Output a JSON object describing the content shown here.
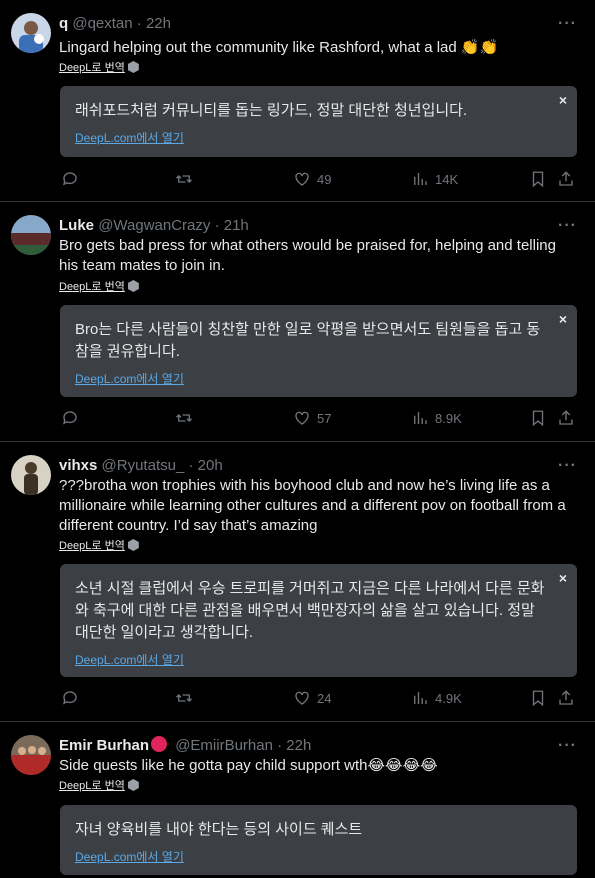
{
  "tweets": [
    {
      "name": "q",
      "handle": "@qextan",
      "time": "· 22h",
      "verified_badge": false,
      "text": "Lingard helping out the community like Rashford, what a lad 👏👏",
      "deepl_label": "DeepL로 번역",
      "translation": "래쉬포드처럼 커뮤니티를 돕는 링가드, 정말 대단한 청년입니다.",
      "translation_link": "DeepL.com에서 열기",
      "likes": "49",
      "views": "14K",
      "avatar_color": "#3b6fb6"
    },
    {
      "name": "Luke",
      "handle": "@WagwanCrazy",
      "time": "· 21h",
      "verified_badge": false,
      "text": "Bro gets bad press for what others would be praised for, helping and telling his team mates to join in.",
      "deepl_label": "DeepL로 번역",
      "translation": "Bro는 다른 사람들이 칭찬할 만한 일로 악평을 받으면서도 팀원들을 돕고 동참을 권유합니다.",
      "translation_link": "DeepL.com에서 열기",
      "likes": "57",
      "views": "8.9K",
      "avatar_color": "#2f5d3a"
    },
    {
      "name": "vihxs",
      "handle": "@Ryutatsu_",
      "time": "· 20h",
      "verified_badge": false,
      "text": "???brotha won trophies with his boyhood club and now he’s living life as a millionaire while learning other cultures and a different pov on football from a different country. I’d say that’s amazing",
      "deepl_label": "DeepL로 번역",
      "translation": "소년 시절 클럽에서 우승 트로피를 거머쥐고 지금은 다른 나라에서 다른 문화와 축구에 대한 다른 관점을 배우면서 백만장자의 삶을 살고 있습니다. 정말 대단한 일이라고 생각합니다.",
      "translation_link": "DeepL.com에서 열기",
      "likes": "24",
      "views": "4.9K",
      "avatar_color": "#8a7a5c"
    },
    {
      "name": "Emir Burhan",
      "handle": "@EmiirBurhan",
      "time": "· 22h",
      "verified_badge": true,
      "text": "Side quests like he gotta pay child support wth😂😂😂😂",
      "deepl_label": "DeepL로 번역",
      "translation": "자녀 양육비를 내야 한다는 등의 사이드 퀘스트",
      "translation_link": "DeepL.com에서 열기",
      "likes": "",
      "views": "",
      "avatar_color": "#b02a2a"
    }
  ],
  "more_icon": "···",
  "close_icon": "×",
  "icons": [
    "reply-icon",
    "retweet-icon",
    "like-icon",
    "views-icon",
    "bookmark-icon",
    "share-icon"
  ],
  "colors": {
    "background": "#000000",
    "text": "#e7e9ea",
    "muted": "#71767b",
    "box": "#3c3f44",
    "link": "#5aa9e6",
    "badge": "#e0245e"
  }
}
